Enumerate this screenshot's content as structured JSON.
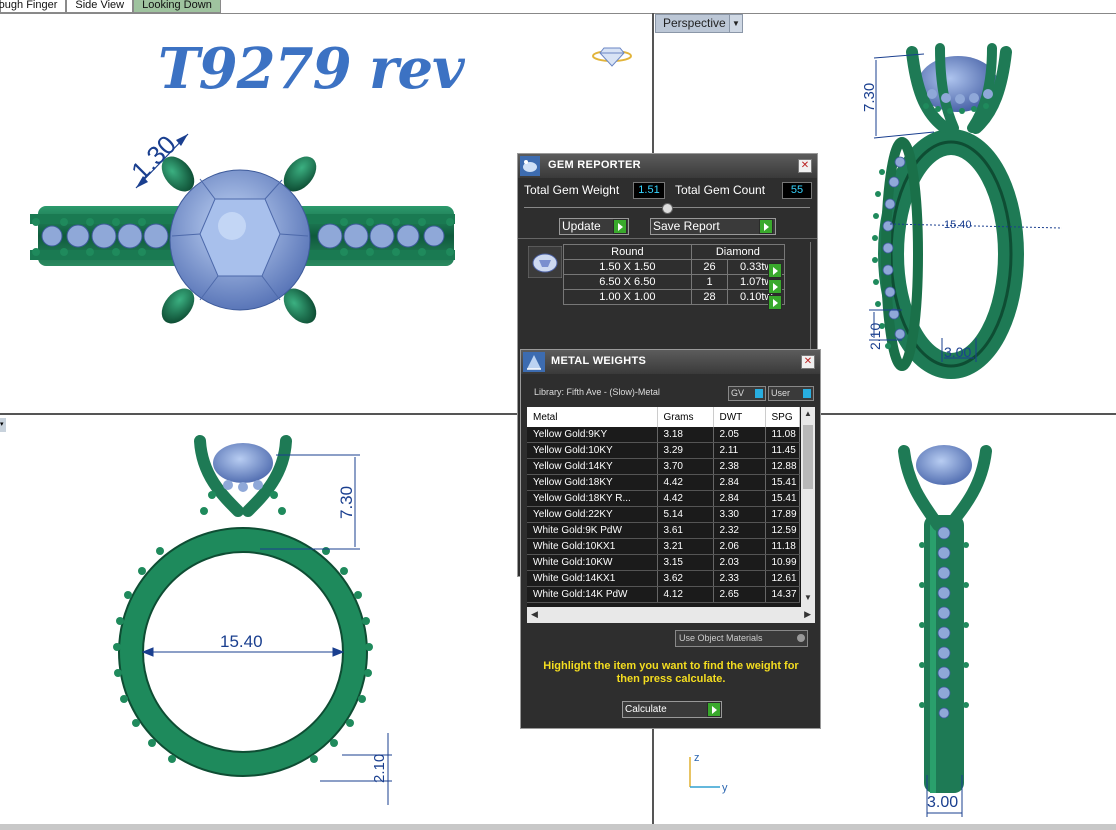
{
  "viewports": {
    "tabs": [
      "rough Finger",
      "Side View",
      "Looking Down"
    ],
    "active_tab": "Looking Down",
    "perspective_label": "Perspective"
  },
  "title": "T9279 rev",
  "dimensions": {
    "top": "1.30",
    "perspective_height": "7.30",
    "perspective_width": "15.40",
    "perspective_band": "2.10",
    "perspective_shank": "3.00",
    "front_height": "7.30",
    "front_width": "15.40",
    "front_band": "2.10",
    "right_width": "3.00"
  },
  "axis": {
    "z": "z",
    "y": "y"
  },
  "gem_reporter": {
    "title": "GEM REPORTER",
    "total_weight_label": "Total Gem Weight",
    "total_weight_value": "1.51",
    "total_count_label": "Total Gem Count",
    "total_count_value": "55",
    "update_label": "Update",
    "save_label": "Save Report",
    "header_shape": "Round",
    "header_material": "Diamond",
    "rows": [
      {
        "size": "1.50 X 1.50",
        "count": "26",
        "weight": "0.33tw"
      },
      {
        "size": "6.50 X 6.50",
        "count": "1",
        "weight": "1.07tw"
      },
      {
        "size": "1.00 X 1.00",
        "count": "28",
        "weight": "0.10tw"
      }
    ]
  },
  "metal_weights": {
    "title": "METAL WEIGHTS",
    "library": "Library: Fifth Ave - (Slow)-Metal",
    "gv_label": "GV",
    "user_label": "User",
    "columns": [
      "Metal",
      "Grams",
      "DWT",
      "SPG"
    ],
    "rows": [
      [
        "Yellow Gold:9KY",
        "3.18",
        "2.05",
        "11.08"
      ],
      [
        "Yellow Gold:10KY",
        "3.29",
        "2.11",
        "11.45"
      ],
      [
        "Yellow Gold:14KY",
        "3.70",
        "2.38",
        "12.88"
      ],
      [
        "Yellow Gold:18KY",
        "4.42",
        "2.84",
        "15.41"
      ],
      [
        "Yellow Gold:18KY R...",
        "4.42",
        "2.84",
        "15.41"
      ],
      [
        "Yellow Gold:22KY",
        "5.14",
        "3.30",
        "17.89"
      ],
      [
        "White Gold:9K PdW",
        "3.61",
        "2.32",
        "12.59"
      ],
      [
        "White Gold:10KX1",
        "3.21",
        "2.06",
        "11.18"
      ],
      [
        "White Gold:10KW",
        "3.15",
        "2.03",
        "10.99"
      ],
      [
        "White Gold:14KX1",
        "3.62",
        "2.33",
        "12.61"
      ],
      [
        "White Gold:14K PdW",
        "4.12",
        "2.65",
        "14.37"
      ]
    ],
    "use_object_materials": "Use Object Materials",
    "hint": "Highlight the item you want to find the weight for then press calculate.",
    "calculate_label": "Calculate"
  },
  "colors": {
    "metal": "#1e7a55",
    "gem": "#8fa8d8",
    "dimension": "#1a3f8f",
    "title": "#3c72c3"
  }
}
